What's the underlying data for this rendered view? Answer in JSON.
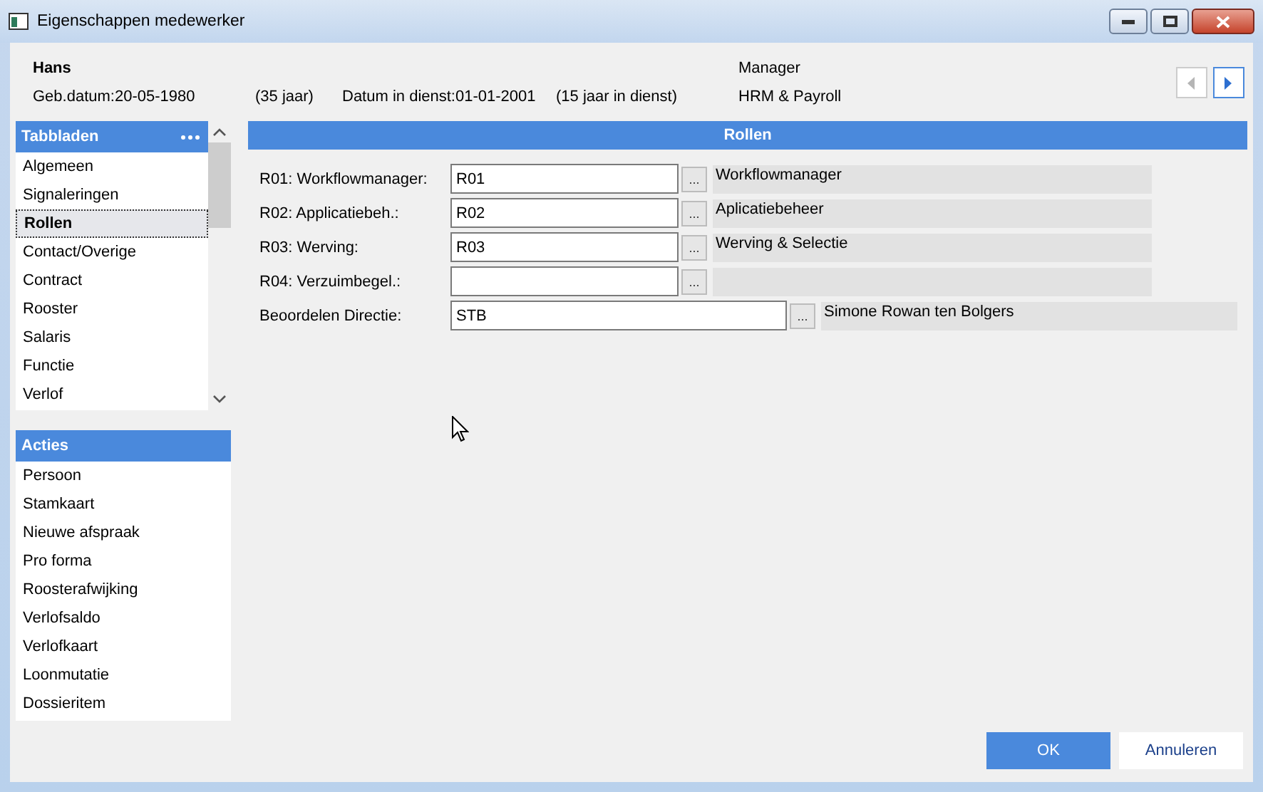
{
  "window": {
    "title": "Eigenschappen medewerker"
  },
  "employee": {
    "name": "Hans",
    "birth_date": "Geb.datum:20-05-1980",
    "age": "(35 jaar)",
    "service_date": "Datum in dienst:01-01-2001",
    "service_years": "(15 jaar in dienst)",
    "function": "Manager",
    "department": "HRM & Payroll"
  },
  "nav": {
    "previous_disabled": true,
    "next_disabled": false
  },
  "tabbladen": {
    "title": "Tabbladen",
    "items": [
      {
        "label": "Algemeen",
        "selected": false
      },
      {
        "label": "Signaleringen",
        "selected": false
      },
      {
        "label": "Rollen",
        "selected": true
      },
      {
        "label": "Contact/Overige",
        "selected": false
      },
      {
        "label": "Contract",
        "selected": false
      },
      {
        "label": "Rooster",
        "selected": false
      },
      {
        "label": "Salaris",
        "selected": false
      },
      {
        "label": "Functie",
        "selected": false
      },
      {
        "label": "Verlof",
        "selected": false
      }
    ]
  },
  "acties": {
    "title": "Acties",
    "items": [
      "Persoon",
      "Stamkaart",
      "Nieuwe afspraak",
      "Pro forma",
      "Roosterafwijking",
      "Verlofsaldo",
      "Verlofkaart",
      "Loonmutatie",
      "Dossieritem"
    ]
  },
  "panel": {
    "title": "Rollen",
    "rows": [
      {
        "label": "R01: Workflowmanager:",
        "value": "R01",
        "lookup": "...",
        "description": "Workflowmanager",
        "kind": "short"
      },
      {
        "label": "R02: Applicatiebeh.:",
        "value": "R02",
        "lookup": "...",
        "description": "Aplicatiebeheer",
        "kind": "short"
      },
      {
        "label": "R03: Werving:",
        "value": "R03",
        "lookup": "...",
        "description": "Werving & Selectie",
        "kind": "short"
      },
      {
        "label": "R04: Verzuimbegel.:",
        "value": "",
        "lookup": "...",
        "description": "",
        "kind": "short"
      },
      {
        "label": "Beoordelen Directie:",
        "value": "STB",
        "lookup": "...",
        "description": "Simone Rowan ten Bolgers",
        "kind": "wide"
      }
    ]
  },
  "buttons": [
    {
      "label": "OK",
      "kind": "primary"
    },
    {
      "label": "Annuleren",
      "kind": "secondary"
    }
  ]
}
